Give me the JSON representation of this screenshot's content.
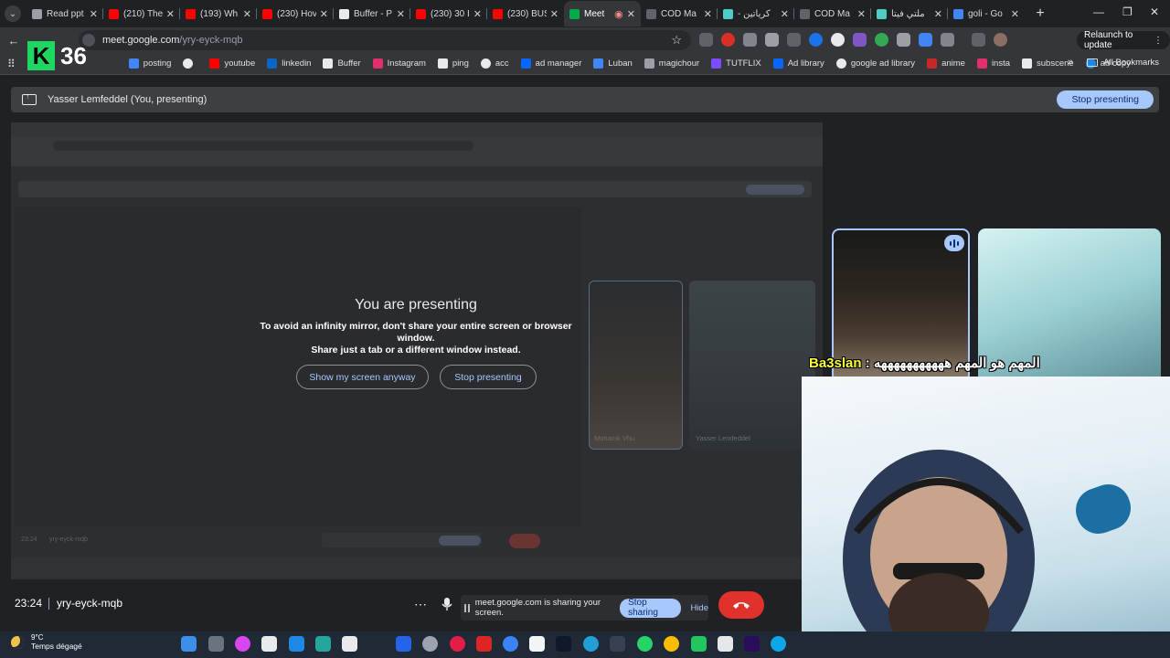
{
  "tabs": [
    {
      "label": "Read ppt",
      "color": "#9aa0a6"
    },
    {
      "label": "(210) The",
      "color": "#ff0000"
    },
    {
      "label": "(193) Wh",
      "color": "#ff0000"
    },
    {
      "label": "(230) Hov",
      "color": "#ff0000"
    },
    {
      "label": "Buffer - P",
      "color": "#e8eaed"
    },
    {
      "label": "(230) 30 I",
      "color": "#ff0000"
    },
    {
      "label": "(230) BUS",
      "color": "#ff0000"
    },
    {
      "label": "Meet",
      "color": "#00ac47"
    },
    {
      "label": "COD Ma",
      "color": "#5f6368"
    },
    {
      "label": "- كرياتين",
      "color": "#4ecdc4"
    },
    {
      "label": "COD Ma",
      "color": "#5f6368"
    },
    {
      "label": "ملتي فيتا",
      "color": "#4ecdc4"
    },
    {
      "label": "goli - Go",
      "color": "#4285f4"
    }
  ],
  "address": {
    "host": "meet.google.com",
    "path": "/yry-eyck-mqb"
  },
  "brand": {
    "letter": "K",
    "number": "36"
  },
  "relaunch_label": "Relaunch to update",
  "bookmarks": [
    {
      "label": "posting",
      "color": "#4285f4"
    },
    {
      "label": "youtube",
      "color": "#ff0000"
    },
    {
      "label": "linkedin",
      "color": "#0a66c2"
    },
    {
      "label": "Buffer",
      "color": "#e8eaed"
    },
    {
      "label": "Instagram",
      "color": "#e1306c"
    },
    {
      "label": "ping",
      "color": "#e8eaed"
    },
    {
      "label": "acc",
      "color": "#e8eaed"
    },
    {
      "label": "ad manager",
      "color": "#0866ff"
    },
    {
      "label": "Luban",
      "color": "#4285f4"
    },
    {
      "label": "magichour",
      "color": "#9aa0a6"
    },
    {
      "label": "TUTFLIX",
      "color": "#7c4dff"
    },
    {
      "label": "Ad library",
      "color": "#0866ff"
    },
    {
      "label": "google ad library",
      "color": "#e8eaed"
    },
    {
      "label": "anime",
      "color": "#c62828"
    },
    {
      "label": "insta",
      "color": "#e1306c"
    },
    {
      "label": "subscene",
      "color": "#e8eaed"
    },
    {
      "label": "ad copy",
      "color": "#1e88e5"
    }
  ],
  "all_bookmarks_label": "All Bookmarks",
  "presenting_bar": {
    "label": "Yasser Lemfeddel (You, presenting)",
    "button": "Stop presenting"
  },
  "dialog": {
    "title": "You are presenting",
    "message_line1": "To avoid an infinity mirror, don't share your entire screen or browser window.",
    "message_line2": "Share just a tab or a different window instead.",
    "show_anyway": "Show my screen anyway",
    "stop_presenting": "Stop presenting"
  },
  "mirror": {
    "tile1_name": "Mohamk Vhu",
    "tile2_name": "Yasser Lemfeddel",
    "clock": "23:24",
    "code": "yry-eyck-mqb"
  },
  "caption": {
    "name": "Ba3slan",
    "message": ": المهم هو المهم هههههههههههه"
  },
  "meeting": {
    "time": "23:24",
    "code": "yry-eyck-mqb"
  },
  "sharebar": {
    "text": "meet.google.com is sharing your screen.",
    "stop": "Stop sharing",
    "hide": "Hide"
  },
  "weather": {
    "temp": "9°C",
    "condition": "Temps dégagé"
  },
  "colors": {
    "accent": "#a8c7fa",
    "end_call": "#e1312c",
    "caption_name": "#f7ff3c"
  }
}
